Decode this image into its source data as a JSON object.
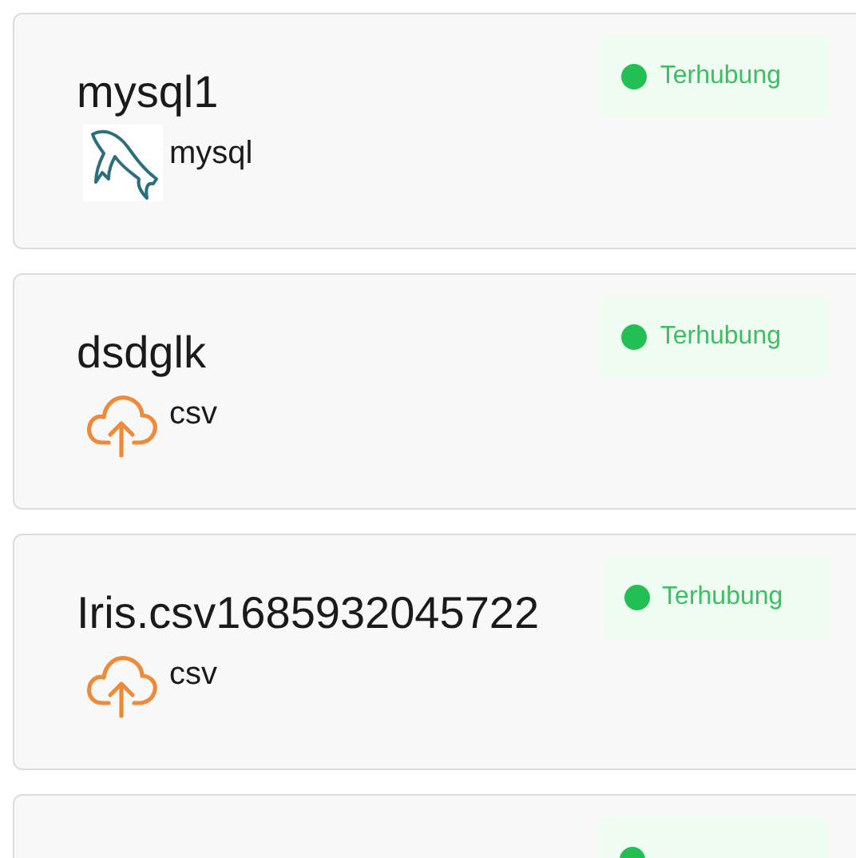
{
  "connections": [
    {
      "name": "mysql1",
      "status": {
        "kind": "connected",
        "label": "Terhubung"
      },
      "source": {
        "kind": "database",
        "label": "mysql"
      }
    },
    {
      "name": "dsdglk",
      "status": {
        "kind": "connected",
        "label": "Terhubung"
      },
      "source": {
        "kind": "upload",
        "label": "csv"
      }
    },
    {
      "name": "Iris.csv1685932045722",
      "status": {
        "kind": "connected",
        "label": "Terhubung"
      },
      "source": {
        "kind": "upload",
        "label": "csv"
      }
    },
    {
      "status": {
        "kind": "connected"
      }
    }
  ]
}
